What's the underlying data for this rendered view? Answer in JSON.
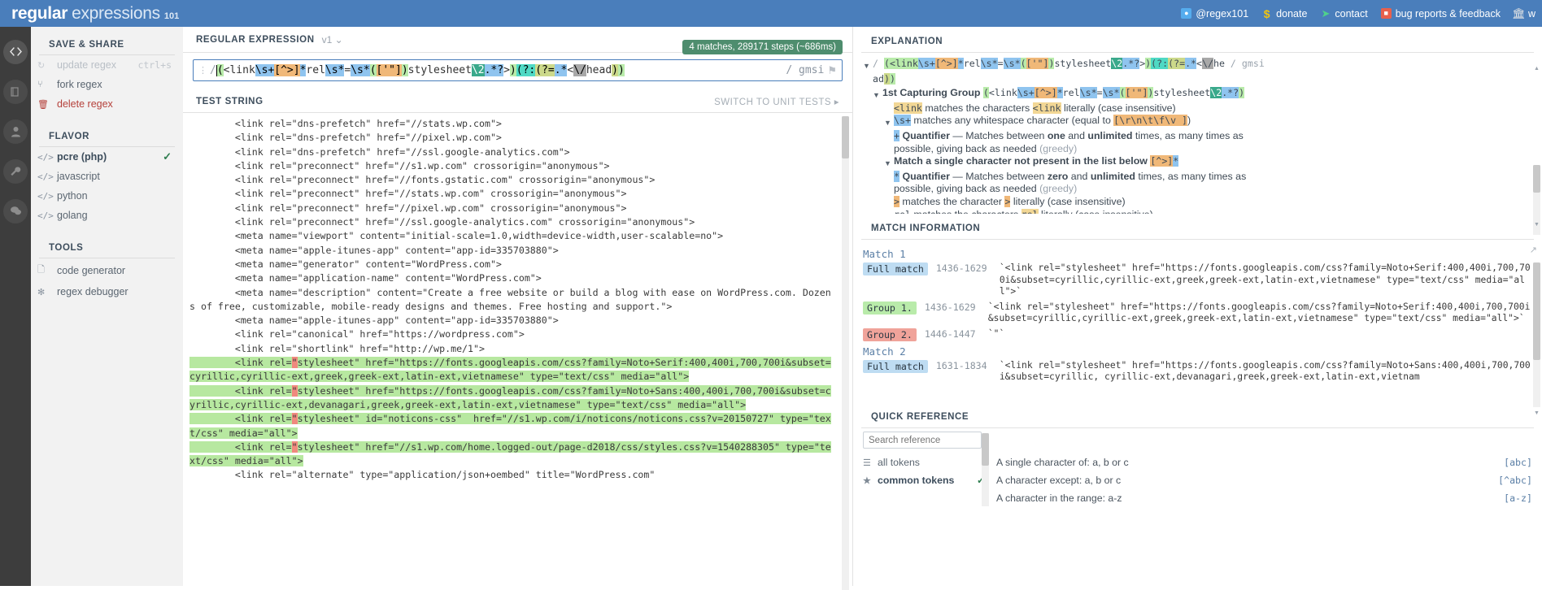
{
  "topbar": {
    "logo": {
      "part1": "regular",
      "part2": "expressions",
      "part3": "101"
    },
    "links": [
      {
        "icon": "twitter-icon",
        "label": "@regex101"
      },
      {
        "icon": "dollar-icon",
        "label": "donate"
      },
      {
        "icon": "paper-plane-icon",
        "label": "contact"
      },
      {
        "icon": "bug-icon",
        "label": "bug reports & feedback"
      },
      {
        "icon": "bank-icon",
        "label": "w"
      }
    ]
  },
  "rail": [
    {
      "name": "code-icon",
      "glyph": "‹›",
      "active": true
    },
    {
      "name": "library-icon",
      "glyph": "❐",
      "active": false
    },
    {
      "name": "account-icon",
      "glyph": "●",
      "active": false
    },
    {
      "name": "wrench-icon",
      "glyph": "⚒",
      "active": false
    },
    {
      "name": "chat-icon",
      "glyph": "⌨",
      "active": false
    }
  ],
  "sidebar": {
    "save_share_heading": "SAVE & SHARE",
    "save_share_items": [
      {
        "label": "update regex",
        "shortcut": "ctrl+s",
        "icon": "refresh-icon",
        "disabled": true
      },
      {
        "label": "fork regex",
        "shortcut": "",
        "icon": "fork-icon",
        "disabled": false
      },
      {
        "label": "delete regex",
        "shortcut": "",
        "icon": "trash-icon",
        "disabled": false,
        "danger": true
      }
    ],
    "flavor_heading": "FLAVOR",
    "flavors": [
      {
        "label": "pcre (php)",
        "selected": true
      },
      {
        "label": "javascript",
        "selected": false
      },
      {
        "label": "python",
        "selected": false
      },
      {
        "label": "golang",
        "selected": false
      }
    ],
    "tools_heading": "TOOLS",
    "tools": [
      {
        "label": "code generator",
        "icon": "file-code-icon"
      },
      {
        "label": "regex debugger",
        "icon": "bug-debug-icon"
      }
    ]
  },
  "regex_panel": {
    "heading": "REGULAR EXPRESSION",
    "version": "v1",
    "version_caret": "⌄",
    "pattern": "(<link\\s+[^>]*rel\\s*=\\s*(['\"])stylesheet\\2.*?>)(?:(?=.*<\\/head))",
    "delimiter": "/",
    "flags": "/ gmsi",
    "flag_icon": "⚑",
    "match_badge": "4 matches, 289171 steps (~686ms)",
    "grip_icon": "⋮"
  },
  "test_string": {
    "heading": "TEST STRING",
    "switch_label": "SWITCH TO UNIT TESTS ▸",
    "lines": [
      {
        "text": "        <link rel=\"dns-prefetch\" href=\"//stats.wp.com\">",
        "highlight": "none"
      },
      {
        "text": "        <link rel=\"dns-prefetch\" href=\"//pixel.wp.com\">",
        "highlight": "none"
      },
      {
        "text": "        <link rel=\"dns-prefetch\" href=\"//ssl.google-analytics.com\">",
        "highlight": "none"
      },
      {
        "text": "        <link rel=\"preconnect\" href=\"//s1.wp.com\" crossorigin=\"anonymous\">",
        "highlight": "none"
      },
      {
        "text": "        <link rel=\"preconnect\" href=\"//fonts.gstatic.com\" crossorigin=\"anonymous\">",
        "highlight": "none"
      },
      {
        "text": "        <link rel=\"preconnect\" href=\"//stats.wp.com\" crossorigin=\"anonymous\">",
        "highlight": "none"
      },
      {
        "text": "        <link rel=\"preconnect\" href=\"//pixel.wp.com\" crossorigin=\"anonymous\">",
        "highlight": "none"
      },
      {
        "text": "        <link rel=\"preconnect\" href=\"//ssl.google-analytics.com\" crossorigin=\"anonymous\">",
        "highlight": "none"
      },
      {
        "text": "        <meta name=\"viewport\" content=\"initial-scale=1.0,width=device-width,user-scalable=no\">",
        "highlight": "none"
      },
      {
        "text": "        <meta name=\"apple-itunes-app\" content=\"app-id=335703880\">",
        "highlight": "none"
      },
      {
        "text": "        <meta name=\"generator\" content=\"WordPress.com\">",
        "highlight": "none"
      },
      {
        "text": "        <meta name=\"application-name\" content=\"WordPress.com\">",
        "highlight": "none"
      },
      {
        "text": "        <meta name=\"description\" content=\"Create a free website or build a blog with ease on WordPress.com. Dozens of free, customizable, mobile-ready designs and themes. Free hosting and support.\">",
        "highlight": "none"
      },
      {
        "text": "        <meta name=\"apple-itunes-app\" content=\"app-id=335703880\">",
        "highlight": "none"
      },
      {
        "text": "        <link rel=\"canonical\" href=\"https://wordpress.com\">",
        "highlight": "none"
      },
      {
        "text": "        <link rel=\"shortlink\" href=\"http://wp.me/1\">",
        "highlight": "none"
      }
    ],
    "matched_blocks": [
      "        <link rel=\"stylesheet\" href=\"https://fonts.googleapis.com/css?family=Noto+Serif:400,400i,700,700i&subset=cyrillic,cyrillic-ext,greek,greek-ext,latin-ext,vietnamese\" type=\"text/css\" media=\"all\">",
      "        <link rel=\"stylesheet\" href=\"https://fonts.googleapis.com/css?family=Noto+Sans:400,400i,700,700i&subset=cyrillic,cyrillic-ext,devanagari,greek,greek-ext,latin-ext,vietnamese\" type=\"text/css\" media=\"all\">",
      "        <link rel=\"stylesheet\" id=\"noticons-css\"  href=\"//s1.wp.com/i/noticons/noticons.css?v=20150727\" type=\"text/css\" media=\"all\">",
      "        <link rel=\"stylesheet\" href=\"//s1.wp.com/home.logged-out/page-d2018/css/styles.css?v=1540288305\" type=\"text/css\" media=\"all\">"
    ],
    "tail_line": "        <link rel=\"alternate\" type=\"application/json+oembed\" title=\"WordPress.com\""
  },
  "explanation": {
    "heading": "EXPLANATION",
    "root_line": "/ (<link\\s+[^>]*rel\\s*=\\s*(['\"])stylesheet\\2.*?>)(?:(?=.*<\\/he / gmsi",
    "root_line2": "ad))",
    "nodes": [
      {
        "label": "1st Capturing Group",
        "code": "(<link\\s+[^>]*rel\\s*=\\s*(['\"])stylesheet\\2.*?>)"
      },
      {
        "label": "<link matches the characters",
        "code": "<link",
        "suffix": "literally (case insensitive)"
      },
      {
        "label": "\\s+ matches any whitespace character (equal to",
        "code": "[\\r\\n\\t\\f\\v ]",
        "suffix": ")"
      },
      {
        "label": "+ Quantifier",
        "desc": "— Matches between one and unlimited times, as many times as possible, giving back as needed (greedy)"
      },
      {
        "label": "Match a single character not present in the list below",
        "code": "[^>]*"
      },
      {
        "label": "* Quantifier",
        "desc": "— Matches between zero and unlimited times, as many times as possible, giving back as needed (greedy)"
      },
      {
        "label": "> matches the character",
        "code": ">",
        "suffix": "literally (case insensitive)"
      },
      {
        "label": "rel matches the characters",
        "code": "rel",
        "suffix": "literally (case insensitive)"
      }
    ]
  },
  "match_information": {
    "heading": "MATCH INFORMATION",
    "matches": [
      {
        "title": "Match 1",
        "rows": [
          {
            "tag": "Full match",
            "type": "full",
            "range": "1436-1629",
            "value": "`<link rel=\"stylesheet\" href=\"https://fonts.googleapis.com/css?family=Noto+Serif:400,400i,700,700i&subset=cyrillic,cyrillic-ext,greek,greek-ext,latin-ext,vietnamese\" type=\"text/css\" media=\"all\">`"
          },
          {
            "tag": "Group 1.",
            "type": "g1",
            "range": "1436-1629",
            "value": "`<link rel=\"stylesheet\" href=\"https://fonts.googleapis.com/css?family=Noto+Serif:400,400i,700,700i&subset=cyrillic,cyrillic-ext,greek,greek-ext,latin-ext,vietnamese\" type=\"text/css\" media=\"all\">`"
          },
          {
            "tag": "Group 2.",
            "type": "g2",
            "range": "1446-1447",
            "value": "`\"`"
          }
        ]
      },
      {
        "title": "Match 2",
        "rows": [
          {
            "tag": "Full match",
            "type": "full",
            "range": "1631-1834",
            "value": "`<link rel=\"stylesheet\" href=\"https://fonts.googleapis.com/css?family=Noto+Sans:400,400i,700,700i&subset=cyrillic, cyrillic-ext,devanagari,greek,greek-ext,latin-ext,vietnam"
          }
        ]
      }
    ],
    "export_icon": "↗"
  },
  "quick_reference": {
    "heading": "QUICK REFERENCE",
    "search_placeholder": "Search reference",
    "categories": [
      {
        "label": "all tokens",
        "icon": "tokens-icon",
        "selected": false,
        "checked": false
      },
      {
        "label": "common tokens",
        "icon": "star-icon",
        "selected": true,
        "checked": true
      }
    ],
    "references": [
      {
        "desc": "A single character of: a, b or c",
        "token": "[abc]"
      },
      {
        "desc": "A character except: a, b or c",
        "token": "[^abc]"
      },
      {
        "desc": "A character in the range: a-z",
        "token": "[a-z]"
      }
    ]
  }
}
